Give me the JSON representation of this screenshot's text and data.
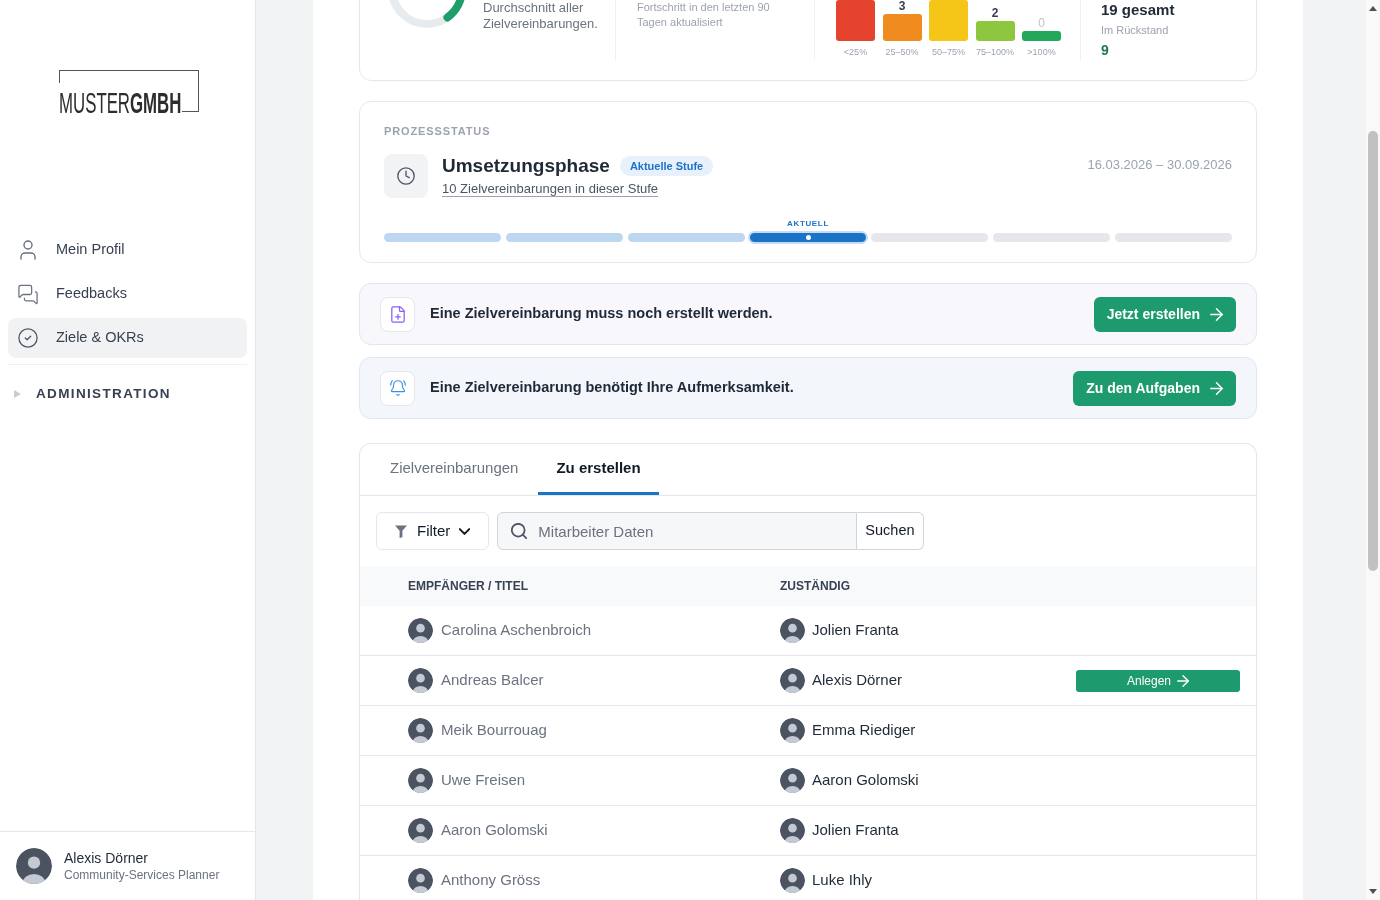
{
  "sidebar": {
    "logo": "MUSTER**GMBH**",
    "nav": [
      {
        "label": "Mein Profil",
        "selected": false
      },
      {
        "label": "Feedbacks",
        "selected": false
      },
      {
        "label": "Ziele & OKRs",
        "selected": true
      }
    ],
    "sections": [
      {
        "label": "ADMINISTRATION",
        "expanded": false
      }
    ],
    "user": {
      "name": "Alexis Dörner",
      "role": "Community-Services Planner"
    }
  },
  "stats": {
    "average": {
      "caption": "Durchschnitt aller Zielvereinbarungen."
    },
    "recent": {
      "caption": "Fortschritt in den letzten 90 Tagen aktualisiert"
    },
    "distribution": [
      {
        "label": "<25%",
        "color": "#e5432d"
      },
      {
        "label": "25–50%",
        "count": "3",
        "muted": false,
        "color": "#f08c1f"
      },
      {
        "label": "50–75%",
        "color": "#f5c518"
      },
      {
        "label": "75–100%",
        "count": "2",
        "muted": false,
        "color": "#8dc63f"
      },
      {
        "label": ">100%",
        "count": "0",
        "muted": true,
        "color": "#22a85a"
      }
    ],
    "total": {
      "value": "19 gesamt",
      "overdue_label": "Im Rückstand",
      "overdue_value": "9"
    }
  },
  "process": {
    "heading": "PROZESSSTATUS",
    "phase": "Umsetzungsphase",
    "badge": "Aktuelle Stufe",
    "link": "10 Zielvereinbarungen in dieser Stufe",
    "dates": "16.03.2026 – 30.09.2026",
    "stages": [
      {
        "kind": "done"
      },
      {
        "kind": "done"
      },
      {
        "kind": "done"
      },
      {
        "kind": "current",
        "label": "AKTUELL"
      },
      {
        "kind": "upcoming"
      },
      {
        "kind": "upcoming"
      },
      {
        "kind": "upcoming"
      }
    ]
  },
  "alerts": [
    {
      "kind": "create",
      "text": "Eine Zielvereinbarung muss noch erstellt werden.",
      "button": "Jetzt erstellen"
    },
    {
      "kind": "attention",
      "text": "Eine Zielvereinbarung benötigt Ihre Aufmerksamkeit.",
      "button": "Zu den Aufgaben"
    }
  ],
  "tabs": [
    {
      "label": "Zielvereinbarungen",
      "selected": false
    },
    {
      "label": "Zu erstellen",
      "selected": true
    }
  ],
  "toolbar": {
    "filter": "Filter",
    "search": {
      "placeholder": "Mitarbeiter Daten"
    },
    "search_button": "Suchen"
  },
  "table": {
    "columns": [
      "EMPFÄNGER / TITEL",
      "ZUSTÄNDIG"
    ],
    "rows": [
      {
        "recipient": "Carolina Aschenbroich",
        "responsible": "Jolien Franta"
      },
      {
        "recipient": "Andreas Balcer",
        "responsible": "Alexis Dörner",
        "action": "Anlegen"
      },
      {
        "recipient": "Meik Bourrouag",
        "responsible": "Emma Riediger"
      },
      {
        "recipient": "Uwe Freisen",
        "responsible": "Aaron Golomski"
      },
      {
        "recipient": "Aaron Golomski",
        "responsible": "Jolien Franta"
      },
      {
        "recipient": "Anthony Gröss",
        "responsible": "Luke Ihly"
      }
    ]
  }
}
